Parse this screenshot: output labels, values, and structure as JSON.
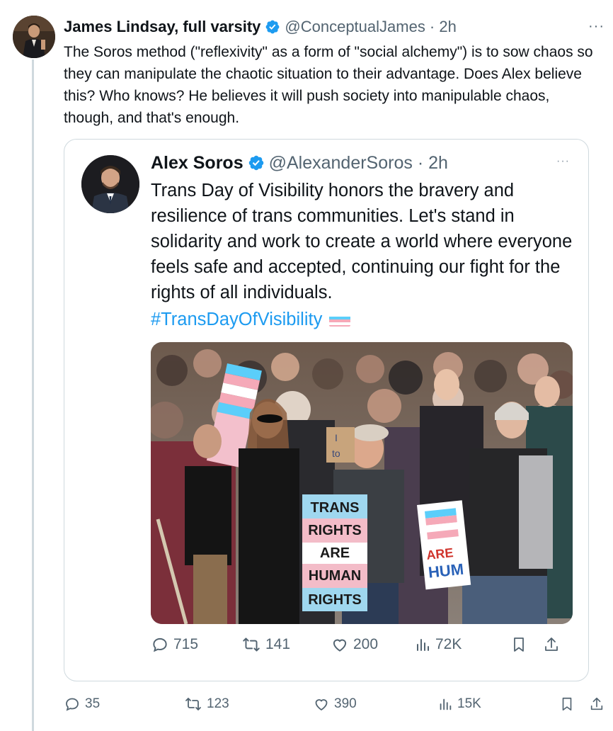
{
  "tweet": {
    "author_name": "James Lindsay, full varsity",
    "handle_time": "@ConceptualJames · 2h",
    "more": "···",
    "text": "The Soros method (\"reflexivity\" as a form of \"social alchemy\") is to sow chaos so they can manipulate the chaotic situation to their advantage. Does Alex believe this? Who knows? He believes it will push society into manipulable chaos, though, and that's enough.",
    "actions": {
      "replies": "35",
      "retweets": "123",
      "likes": "390",
      "views": "15K"
    }
  },
  "quote": {
    "author_name": "Alex Soros",
    "handle_time": "@AlexanderSoros · 2h",
    "more": "···",
    "text": "Trans Day of Visibility honors the bravery and resilience of trans communities. Let's stand in solidarity and work to create a world where everyone feels safe and accepted, continuing our fight for the rights of all individuals.",
    "hashtag": "#TransDayOfVisibility",
    "photo": {
      "sign_main": [
        "TRANS",
        "RIGHTS",
        "ARE",
        "HUMAN",
        "RIGHTS"
      ],
      "sign_left": [
        "I",
        "to"
      ],
      "sign_right": [
        "ARE",
        "HUM"
      ]
    },
    "actions": {
      "replies": "715",
      "retweets": "141",
      "likes": "200",
      "views": "72K"
    }
  },
  "colors": {
    "accent": "#1d9bf0",
    "muted": "#536471",
    "border": "#cfd9de",
    "trans_blue": "#5bcefa",
    "trans_pink": "#f5a9b8"
  }
}
